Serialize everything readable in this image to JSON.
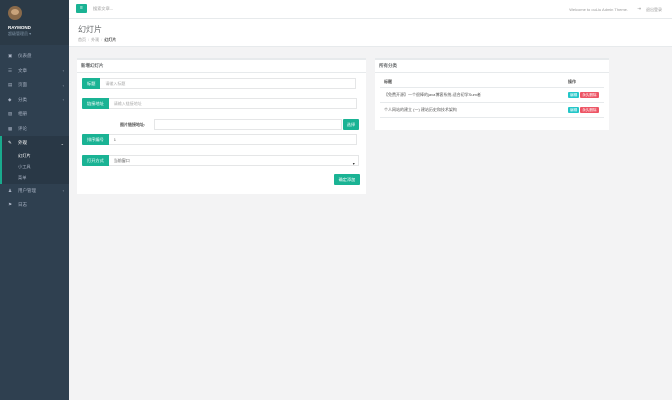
{
  "sidebar": {
    "profile_name": "RAYMOND",
    "profile_role": "超级管理员 ▾",
    "items": [
      {
        "label": "仪表盘",
        "icon": "desktop-icon",
        "glyph": "▣",
        "arrow": ""
      },
      {
        "label": "文章",
        "icon": "list-icon",
        "glyph": "☰",
        "arrow": "‹"
      },
      {
        "label": "页面",
        "icon": "columns-icon",
        "glyph": "▤",
        "arrow": "‹"
      },
      {
        "label": "分类",
        "icon": "tag-icon",
        "glyph": "◆",
        "arrow": "‹"
      },
      {
        "label": "相册",
        "icon": "picture-icon",
        "glyph": "▨",
        "arrow": ""
      },
      {
        "label": "评论",
        "icon": "comment-icon",
        "glyph": "▩",
        "arrow": ""
      }
    ],
    "active_group": {
      "label": "外观",
      "icon": "paint-brush-icon",
      "glyph": "✎",
      "arrow": "⌄"
    },
    "sub_items": [
      {
        "label": "幻灯片",
        "active": true
      },
      {
        "label": "小工具",
        "active": false
      },
      {
        "label": "菜单",
        "active": false
      }
    ],
    "bottom_items": [
      {
        "label": "用户管理",
        "icon": "user-icon",
        "glyph": "♟",
        "arrow": "‹"
      },
      {
        "label": "日志",
        "icon": "flag-icon",
        "glyph": "⚑",
        "arrow": ""
      }
    ]
  },
  "topbar": {
    "menu_glyph": "≡",
    "search_placeholder": "搜索文章...",
    "welcome": "Welcome to ouLiu Admin Theme.",
    "logout_glyph": "⇥",
    "logout": "退出登录"
  },
  "heading": {
    "title": "幻灯片",
    "breadcrumb": [
      "首页",
      "外观",
      "幻灯片"
    ]
  },
  "form": {
    "panel_title": "新增幻灯片",
    "title_label": "标题",
    "title_placeholder": "请输入标题",
    "link_label": "链接地址",
    "link_placeholder": "请输入链接地址",
    "pic_label": "图片链接地址:",
    "pick_button": "选择",
    "order_label": "排序编号",
    "order_value": "1",
    "open_label": "打开方式",
    "open_value": "当前窗口",
    "submit": "确定添加"
  },
  "list": {
    "panel_title": "所有分类",
    "col_title": "标题",
    "col_action": "操作",
    "rows": [
      {
        "title": "【免费开源】一个很棒的java博客系统-适合初学Sum者"
      },
      {
        "title": "个人网站的建立 (一) 建站历史和技术架构"
      }
    ],
    "edit_label": "编辑",
    "delete_label": "永久删除"
  },
  "colors": {
    "accent": "#1ab394",
    "sidebar": "#2f4050",
    "edit": "#23c6c8",
    "delete": "#ed5565"
  }
}
